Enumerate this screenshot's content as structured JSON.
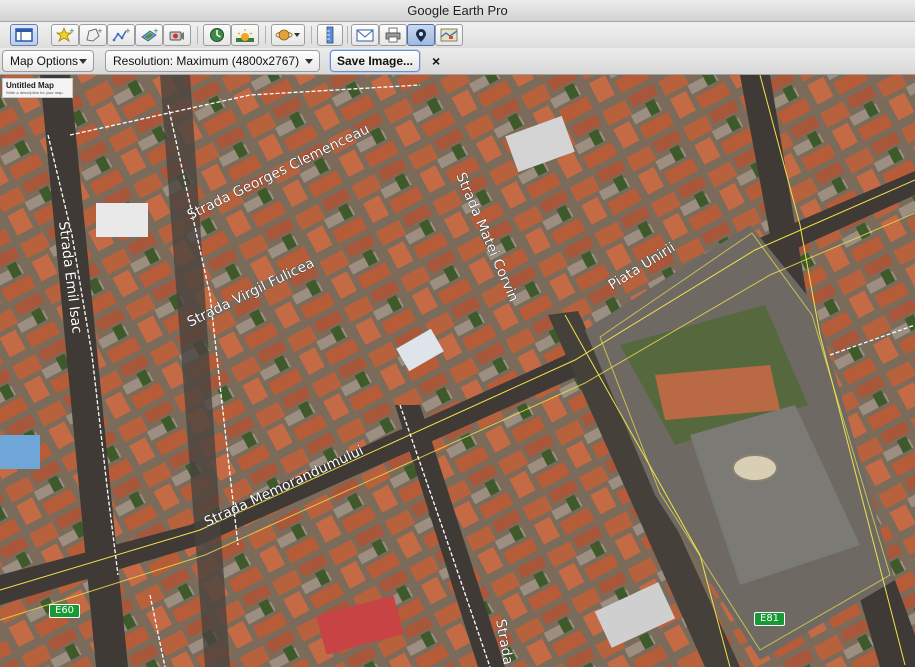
{
  "window": {
    "title": "Google Earth Pro"
  },
  "toolbar": {
    "buttons": [
      {
        "icon": "sidebar-toggle-icon"
      },
      {
        "icon": "add-placemark-icon"
      },
      {
        "icon": "add-polygon-icon"
      },
      {
        "icon": "add-path-icon"
      },
      {
        "icon": "add-image-overlay-icon"
      },
      {
        "icon": "record-tour-icon"
      },
      {
        "icon": "historical-imagery-icon"
      },
      {
        "icon": "sunlight-icon"
      },
      {
        "icon": "switch-planet-icon"
      },
      {
        "icon": "ruler-icon"
      },
      {
        "icon": "email-icon"
      },
      {
        "icon": "print-icon"
      },
      {
        "icon": "save-image-icon"
      },
      {
        "icon": "view-in-maps-icon"
      }
    ]
  },
  "options_bar": {
    "map_options_label": "Map Options",
    "resolution_label": "Resolution: Maximum (4800x2767)",
    "save_image_label": "Save Image...",
    "close_label": "×"
  },
  "map": {
    "legend": {
      "title": "Untitled Map",
      "description": "Write a description for your map."
    },
    "street_labels": [
      "Strada Georges Clemenceau",
      "Strada Virgil Fulicea",
      "Strada Emil Isac",
      "Strada Matei Corvin",
      "Piata Unirii",
      "Strada Memorandumului",
      "Strada"
    ],
    "route_shields": [
      "E60",
      "E81"
    ],
    "colors": {
      "shield_green": "#159a34",
      "road_line_yellow": "#f2e24a",
      "road_line_white": "#ffffff"
    }
  }
}
